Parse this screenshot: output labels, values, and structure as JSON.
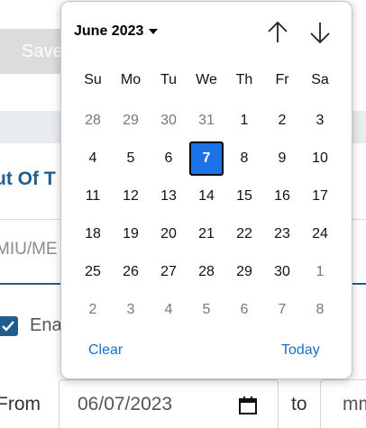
{
  "background": {
    "save_button": "Save",
    "section_title": "ut Of T",
    "field_value": "MIU/ME",
    "checkbox_label": "Ena",
    "date_range": {
      "from_label": "From",
      "from_value": "06/07/2023",
      "to_label": "to",
      "to_value": "mm"
    }
  },
  "calendar": {
    "month_label": "June 2023",
    "weekdays": [
      "Su",
      "Mo",
      "Tu",
      "We",
      "Th",
      "Fr",
      "Sa"
    ],
    "days": [
      {
        "label": "28",
        "muted": true
      },
      {
        "label": "29",
        "muted": true
      },
      {
        "label": "30",
        "muted": true
      },
      {
        "label": "31",
        "muted": true
      },
      {
        "label": "1",
        "muted": false
      },
      {
        "label": "2",
        "muted": false
      },
      {
        "label": "3",
        "muted": false
      },
      {
        "label": "4",
        "muted": false
      },
      {
        "label": "5",
        "muted": false
      },
      {
        "label": "6",
        "muted": false
      },
      {
        "label": "7",
        "muted": false,
        "selected": true
      },
      {
        "label": "8",
        "muted": false
      },
      {
        "label": "9",
        "muted": false
      },
      {
        "label": "10",
        "muted": false
      },
      {
        "label": "11",
        "muted": false
      },
      {
        "label": "12",
        "muted": false
      },
      {
        "label": "13",
        "muted": false
      },
      {
        "label": "14",
        "muted": false
      },
      {
        "label": "15",
        "muted": false
      },
      {
        "label": "16",
        "muted": false
      },
      {
        "label": "17",
        "muted": false
      },
      {
        "label": "18",
        "muted": false
      },
      {
        "label": "19",
        "muted": false
      },
      {
        "label": "20",
        "muted": false
      },
      {
        "label": "21",
        "muted": false
      },
      {
        "label": "22",
        "muted": false
      },
      {
        "label": "23",
        "muted": false
      },
      {
        "label": "24",
        "muted": false
      },
      {
        "label": "25",
        "muted": false
      },
      {
        "label": "26",
        "muted": false
      },
      {
        "label": "27",
        "muted": false
      },
      {
        "label": "28",
        "muted": false
      },
      {
        "label": "29",
        "muted": false
      },
      {
        "label": "30",
        "muted": false
      },
      {
        "label": "1",
        "muted": true
      },
      {
        "label": "2",
        "muted": true
      },
      {
        "label": "3",
        "muted": true
      },
      {
        "label": "4",
        "muted": true
      },
      {
        "label": "5",
        "muted": true
      },
      {
        "label": "6",
        "muted": true
      },
      {
        "label": "7",
        "muted": true
      },
      {
        "label": "8",
        "muted": true
      }
    ],
    "clear_label": "Clear",
    "today_label": "Today"
  },
  "icons": {
    "prev": "arrow-up-icon",
    "next": "arrow-down-icon",
    "dropdown": "caret-down-icon",
    "calendar": "calendar-icon",
    "checkbox": "check-icon"
  },
  "colors": {
    "selected_day": "#1a73e8",
    "link": "#1a6fc4",
    "brand": "#1e5f8f"
  }
}
